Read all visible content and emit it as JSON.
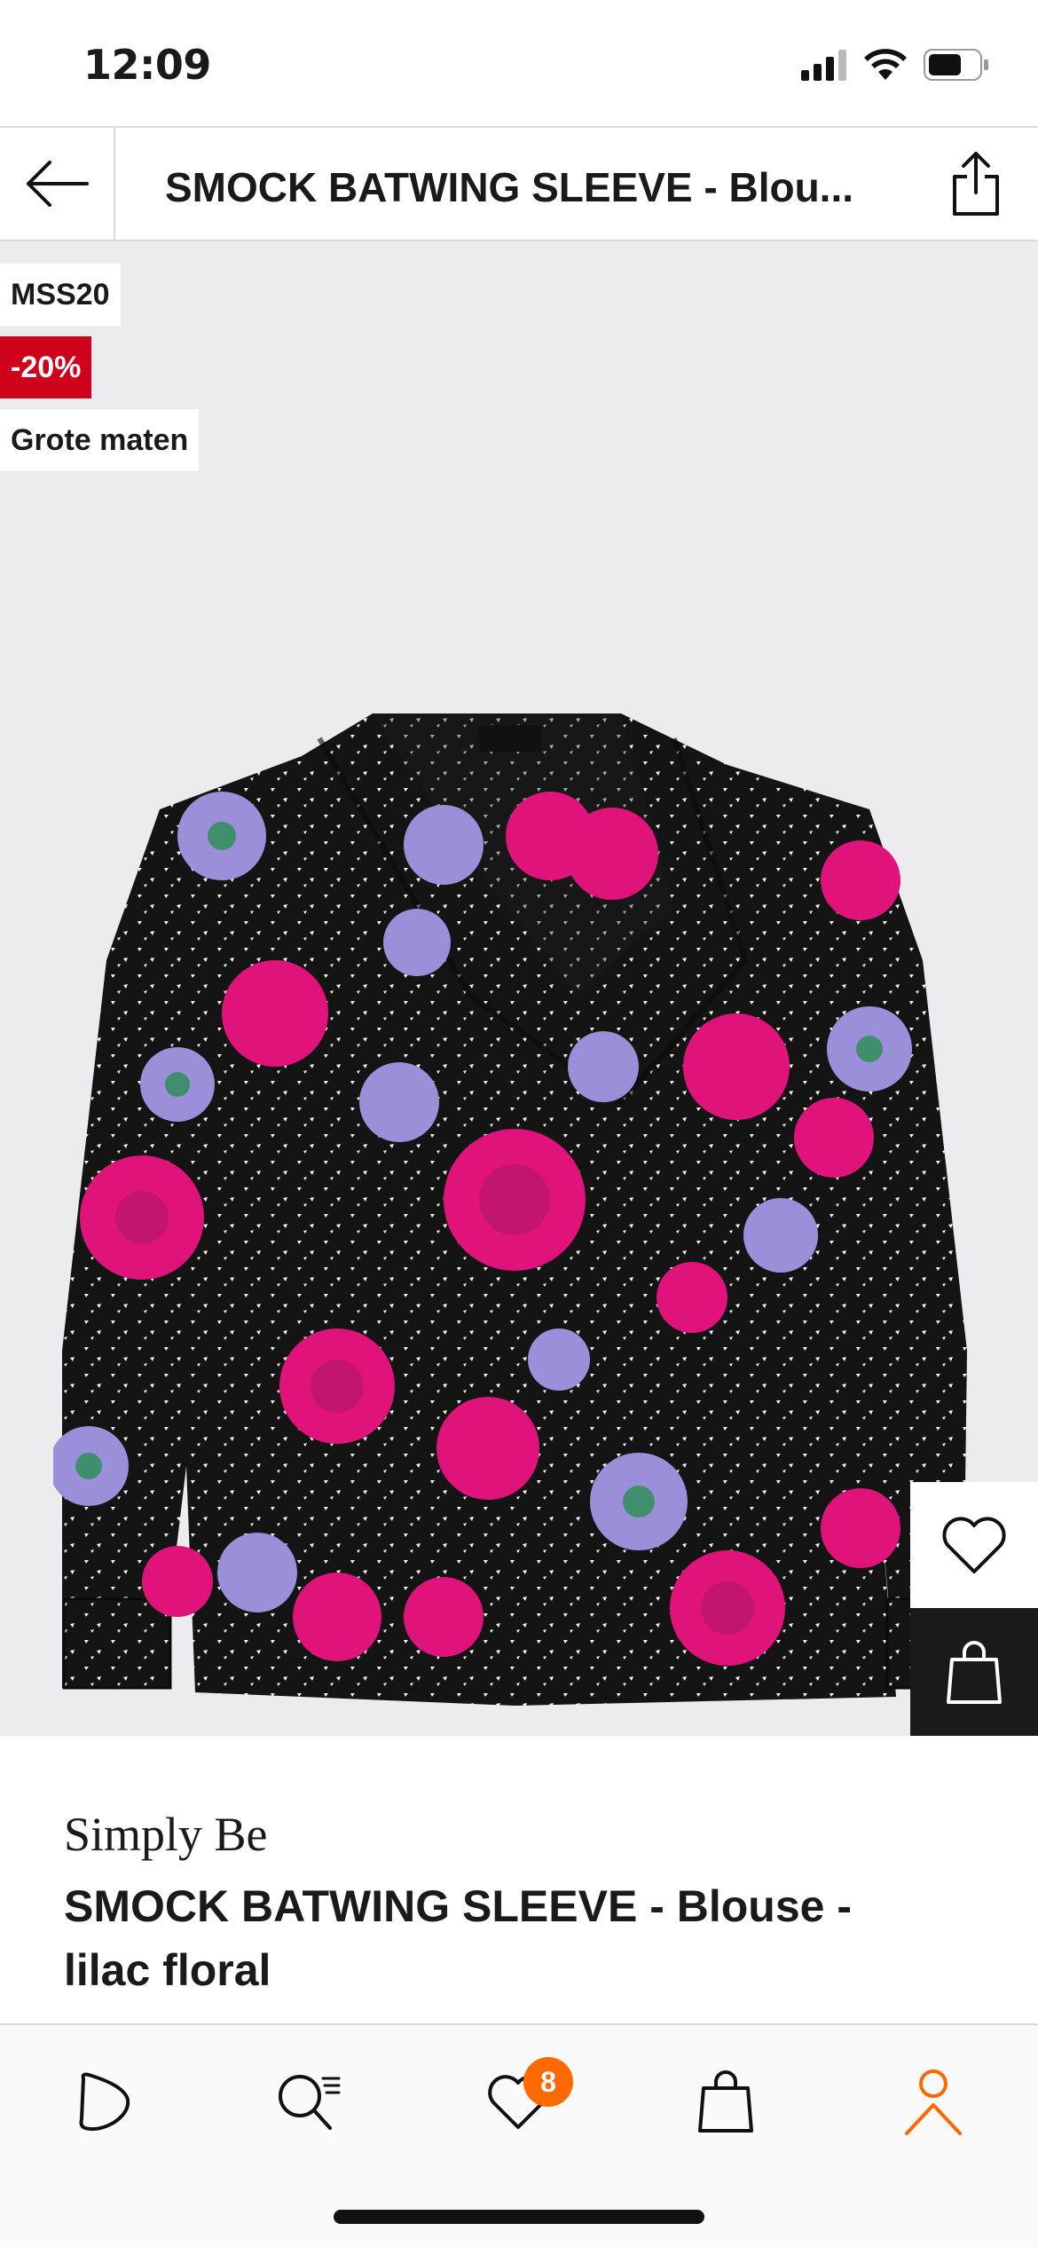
{
  "status_bar": {
    "time": "12:09",
    "battery_level": 0.6
  },
  "header": {
    "title": "SMOCK BATWING SLEEVE  - Blou..."
  },
  "image": {
    "flags": [
      {
        "label": "MSS20",
        "style": "white"
      },
      {
        "label": "-20%",
        "style": "red"
      },
      {
        "label": "Grote maten",
        "style": "white"
      }
    ],
    "gallery_progress": 0.33
  },
  "product": {
    "brand": "Simply Be",
    "name_line1": "SMOCK BATWING SLEEVE  - Blouse -",
    "name_line2": "lilac floral"
  },
  "nav": {
    "wishlist_count": "8",
    "items": [
      "home-icon",
      "search-icon",
      "wishlist-icon",
      "bag-icon",
      "profile-icon"
    ],
    "active_color": "#ff6900"
  },
  "colors": {
    "sale_red": "#d0021b",
    "accent_orange": "#ff6900",
    "dark": "#1a1a1a"
  }
}
